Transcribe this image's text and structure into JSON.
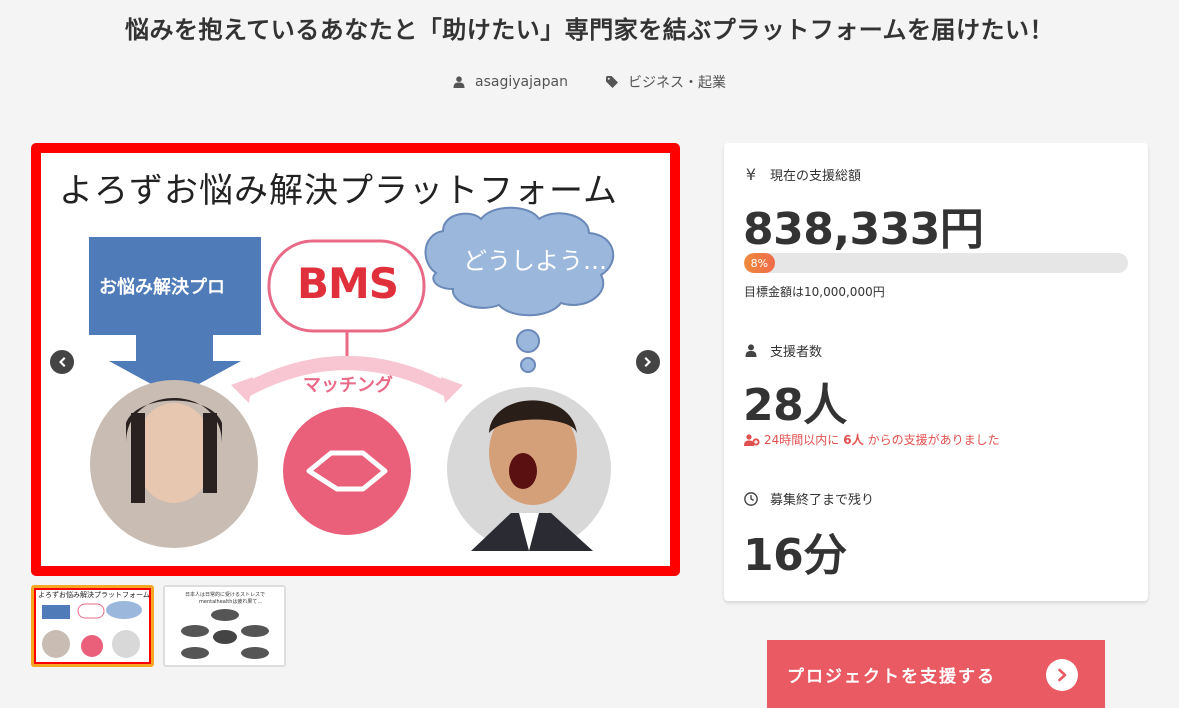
{
  "project": {
    "title": "悩みを抱えているあなたと「助けたい」専門家を結ぶプラットフォームを届けたい！",
    "author": "asagiyajapan",
    "category": "ビジネス・起業"
  },
  "slide": {
    "heading": "よろずお悩み解決プラットフォーム",
    "box_label": "お悩み解決プロ",
    "bms": "BMS",
    "cloud_text": "どうしよう…",
    "matching": "マッチング"
  },
  "thumb2": {
    "line1": "日本人は日常的に受けるストレスで",
    "line2": "mentalhealthは疲れ果て…"
  },
  "stats": {
    "amount_label": "現在の支援総額",
    "amount": "838,333円",
    "progress_text": "8%",
    "progress_value": 0.08,
    "goal_text": "目標金額は10,000,000円",
    "supporters_label": "支援者数",
    "supporters": "28人",
    "recent_prefix": "24時間以内に",
    "recent_count": "6人",
    "recent_suffix": "からの支援がありました",
    "remaining_label": "募集終了まで残り",
    "remaining": "16分"
  },
  "cta": {
    "label": "プロジェクトを支援する"
  },
  "icons": {
    "user": "user-icon",
    "tag": "tag-icon",
    "yen": "yen-icon",
    "clock": "clock-icon",
    "users": "users-icon",
    "chevron": "chevron-right-icon"
  },
  "colors": {
    "accent_red": "#e95a63",
    "frame_red": "#ff0000",
    "progress": "#f07a40",
    "alert": "#e0504e"
  }
}
